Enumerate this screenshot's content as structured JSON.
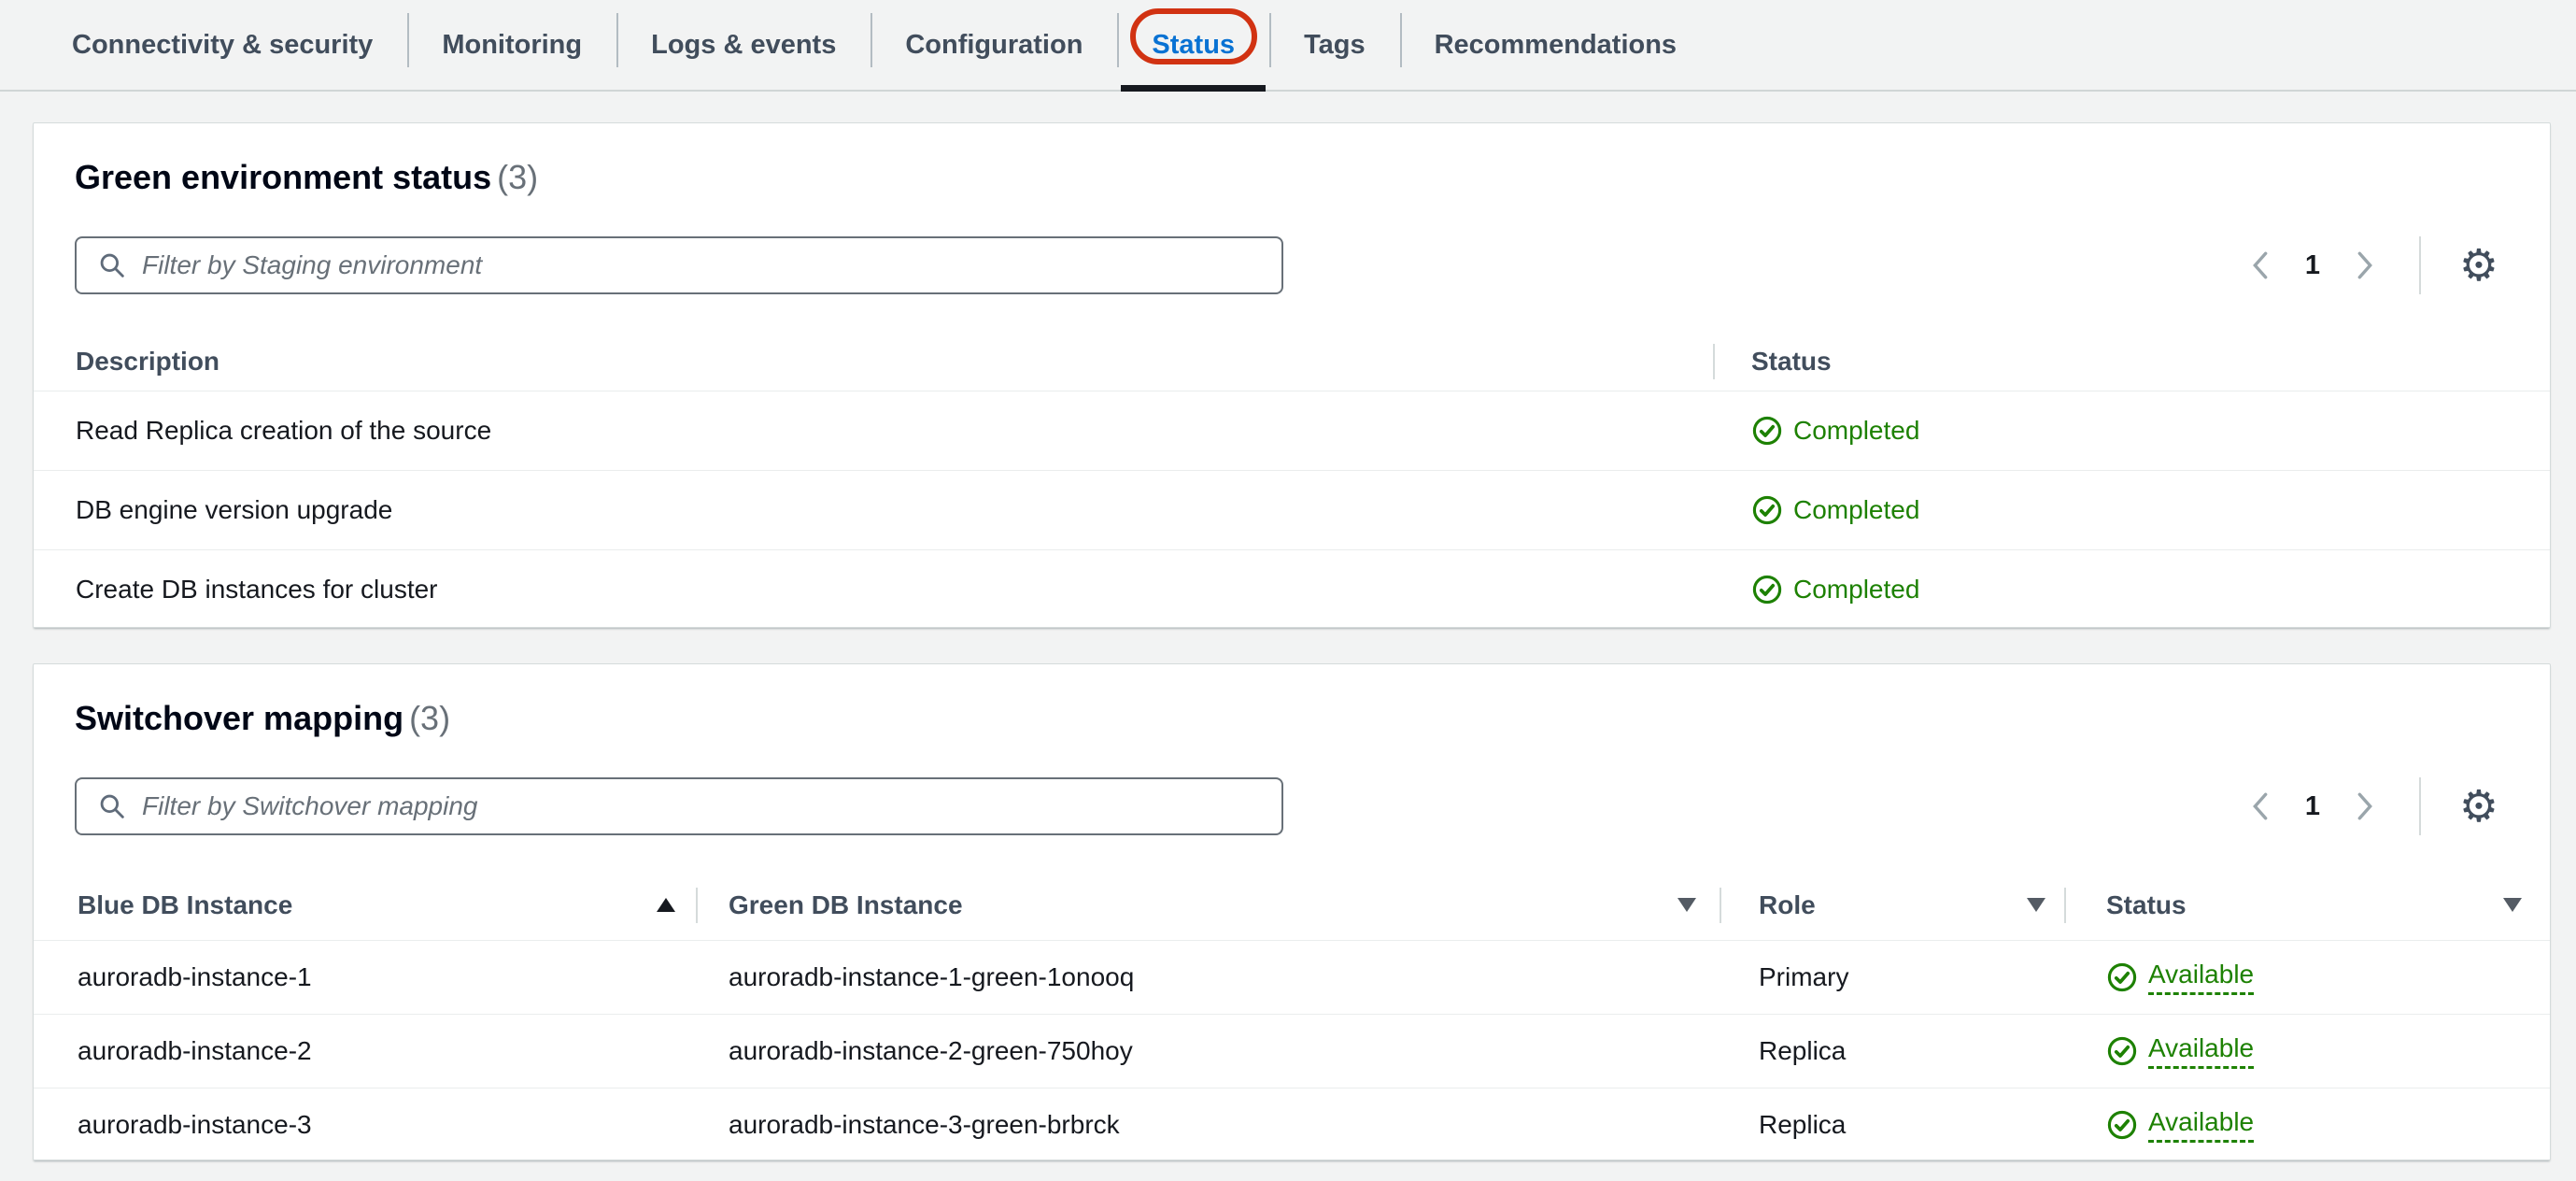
{
  "tab_bar": {
    "tabs": [
      {
        "label": "Connectivity & security"
      },
      {
        "label": "Monitoring"
      },
      {
        "label": "Logs & events"
      },
      {
        "label": "Configuration"
      },
      {
        "label": "Status",
        "active": true,
        "annotated": true
      },
      {
        "label": "Tags"
      },
      {
        "label": "Recommendations"
      }
    ]
  },
  "green_environment_status": {
    "title": "Green environment status",
    "count": "(3)",
    "filter": {
      "placeholder": "Filter by Staging environment",
      "value": ""
    },
    "pagination": {
      "current_page": "1"
    },
    "table": {
      "columns": {
        "description": "Description",
        "status": "Status"
      },
      "rows": [
        {
          "description": "Read Replica creation of the source",
          "status": "Completed"
        },
        {
          "description": "DB engine version upgrade",
          "status": "Completed"
        },
        {
          "description": "Create DB instances for cluster",
          "status": "Completed"
        }
      ]
    }
  },
  "switchover_mapping": {
    "title": "Switchover mapping",
    "count": "(3)",
    "filter": {
      "placeholder": "Filter by Switchover mapping",
      "value": ""
    },
    "pagination": {
      "current_page": "1"
    },
    "table": {
      "columns": {
        "blue": "Blue DB Instance",
        "green": "Green DB Instance",
        "role": "Role",
        "status": "Status"
      },
      "rows": [
        {
          "blue": "auroradb-instance-1",
          "green": "auroradb-instance-1-green-1onooq",
          "role": "Primary",
          "status": "Available"
        },
        {
          "blue": "auroradb-instance-2",
          "green": "auroradb-instance-2-green-750hoy",
          "role": "Replica",
          "status": "Available"
        },
        {
          "blue": "auroradb-instance-3",
          "green": "auroradb-instance-3-green-brbrck",
          "role": "Replica",
          "status": "Available"
        }
      ]
    }
  },
  "icons": {
    "gear": "⚙",
    "search": "search-icon",
    "check_circle": "check-circle-icon"
  },
  "colors": {
    "success_green": "#1d8102",
    "active_tab_blue": "#0972d3",
    "annotation_red": "#d13212",
    "page_background": "#f2f3f3"
  }
}
